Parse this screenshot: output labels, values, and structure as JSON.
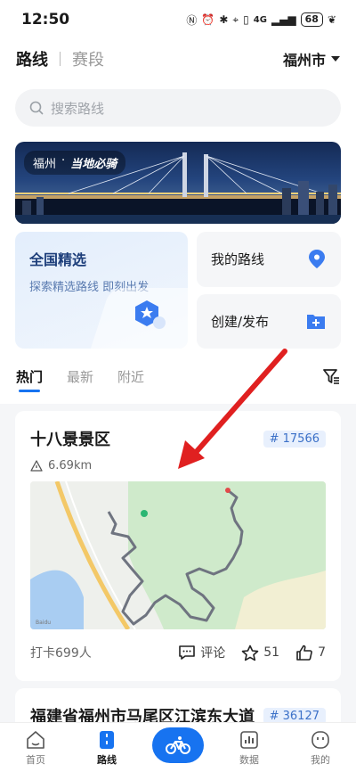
{
  "status": {
    "time": "12:50",
    "battery": "68",
    "signal": "4G"
  },
  "topnav": {
    "tab_active": "路线",
    "tab_other": "赛段",
    "city": "福州市"
  },
  "search": {
    "placeholder": "搜索路线"
  },
  "banner": {
    "city": "福州",
    "dot": "·",
    "slogan": "当地必骑"
  },
  "grid": {
    "select_title": "全国精选",
    "select_sub": "探索精选路线 即刻出发",
    "my_routes": "我的路线",
    "create": "创建/发布"
  },
  "tabs": {
    "items": [
      "热门",
      "最新",
      "附近"
    ]
  },
  "cards": [
    {
      "title": "十八景景区",
      "tag": "17566",
      "distance": "6.69km",
      "checkin": "打卡699人",
      "comment": "评论",
      "stars": "51",
      "likes": "7"
    },
    {
      "title": "福建省福州市马尾区江滨东大道",
      "tag": "36127"
    }
  ],
  "bottom_nav": {
    "home": "首页",
    "routes": "路线",
    "data": "数据",
    "mine": "我的"
  },
  "colors": {
    "accent": "#1773f0",
    "arrow": "#e02020",
    "route": "#6f7480"
  },
  "icons": {
    "search": "search-icon",
    "location": "location-pin-icon",
    "folder": "folder-plus-icon",
    "filter": "filter-icon",
    "ruler": "distance-icon",
    "comment": "comment-icon",
    "star": "star-icon",
    "like": "thumbs-up-icon",
    "bike": "bicycle-icon"
  }
}
